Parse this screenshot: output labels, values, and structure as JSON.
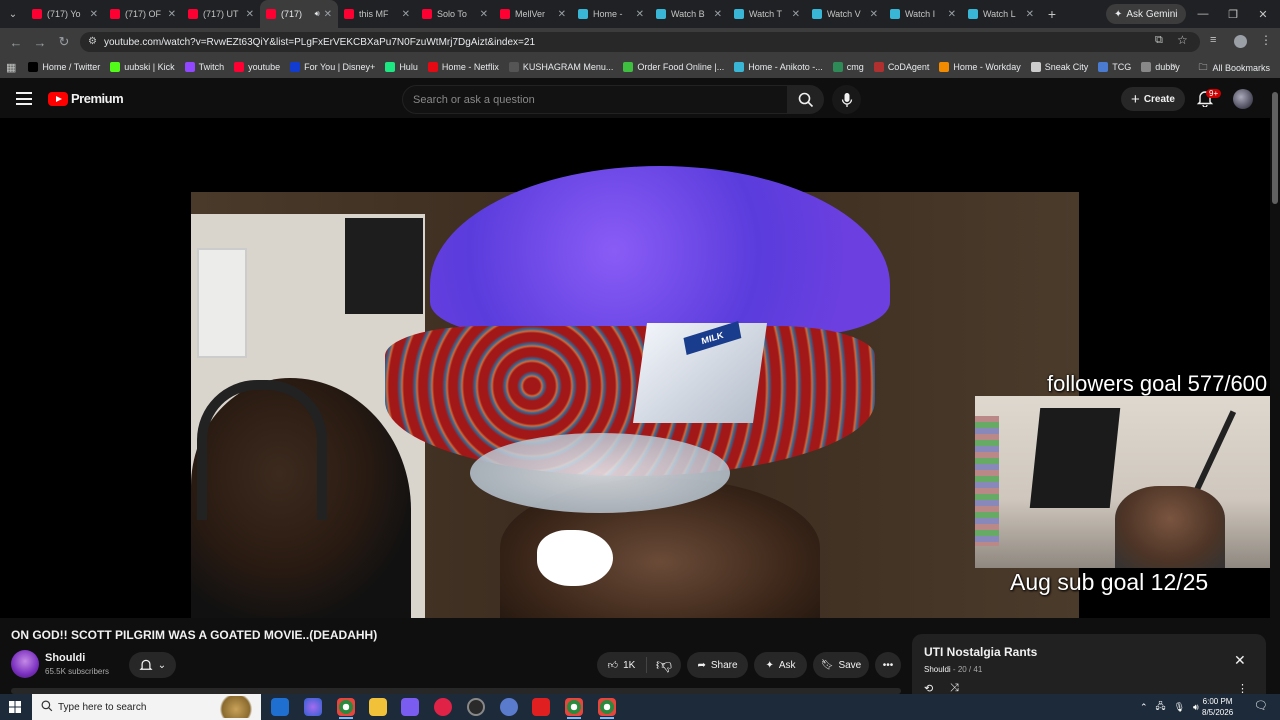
{
  "browser": {
    "tabs": [
      {
        "title": "(717) Yo",
        "color": "#ff0033"
      },
      {
        "title": "(717) OF",
        "color": "#ff0033"
      },
      {
        "title": "(717) UT",
        "color": "#ff0033"
      },
      {
        "title": "(717)",
        "color": "#ff0033",
        "active": true
      },
      {
        "title": "this MF",
        "color": "#ff0033"
      },
      {
        "title": "Solo To",
        "color": "#ff0033"
      },
      {
        "title": "MellVer",
        "color": "#ff0033"
      },
      {
        "title": "Home -",
        "color": "#39b6d6"
      },
      {
        "title": "Watch B",
        "color": "#39b6d6"
      },
      {
        "title": "Watch T",
        "color": "#39b6d6"
      },
      {
        "title": "Watch V",
        "color": "#39b6d6"
      },
      {
        "title": "Watch I",
        "color": "#39b6d6"
      },
      {
        "title": "Watch L",
        "color": "#39b6d6"
      }
    ],
    "new_tab": "+",
    "gemini_label": "Ask Gemini",
    "url": "youtube.com/watch?v=RvwEZt63QiY&list=PLgFxErVEKCBXaPu7N0FzuWtMrj7DgAizt&index=21",
    "bookmarks": [
      {
        "label": "Home / Twitter",
        "color": "#000000"
      },
      {
        "label": "uubski | Kick",
        "color": "#53fc18"
      },
      {
        "label": "Twitch",
        "color": "#9146ff"
      },
      {
        "label": "youtube",
        "color": "#ff0033"
      },
      {
        "label": "For You | Disney+",
        "color": "#113ccf"
      },
      {
        "label": "Hulu",
        "color": "#1ce783"
      },
      {
        "label": "Home - Netflix",
        "color": "#e50914"
      },
      {
        "label": "KUSHAGRAM Menu...",
        "color": "#555555"
      },
      {
        "label": "Order Food Online |...",
        "color": "#3fbf3f"
      },
      {
        "label": "Home - Anikoto -...",
        "color": "#39b6d6"
      },
      {
        "label": "cmg",
        "color": "#2e8b57"
      },
      {
        "label": "CoDAgent",
        "color": "#b03030"
      },
      {
        "label": "Home - Workday",
        "color": "#f38b00"
      },
      {
        "label": "Sneak City",
        "color": "#cccccc"
      },
      {
        "label": "TCG",
        "color": "#4a7bd1"
      },
      {
        "label": "dubby",
        "color": "#888888"
      }
    ],
    "all_bookmarks": "All Bookmarks"
  },
  "youtube": {
    "logo_text": "Premium",
    "search_placeholder": "Search or ask a question",
    "create_label": "Create",
    "notif_count": "9+"
  },
  "video": {
    "overlay_followers": "followers goal 577/600",
    "overlay_subs": "Aug sub goal 12/25",
    "milk_label": "MILK",
    "title": "ON GOD!! SCOTT PILGRIM WAS A GOATED MOVIE..(DEADAHH)",
    "channel": "Shouldi",
    "subscribers": "65.5K subscribers",
    "likes": "1K",
    "share": "Share",
    "ask": "Ask",
    "save": "Save"
  },
  "playlist": {
    "title": "UTI Nostalgia Rants",
    "owner": "Shouldi",
    "position": "20 / 41"
  },
  "taskbar": {
    "search_placeholder": "Type here to search",
    "time": "6:00 PM",
    "date": "8/5/2026"
  }
}
